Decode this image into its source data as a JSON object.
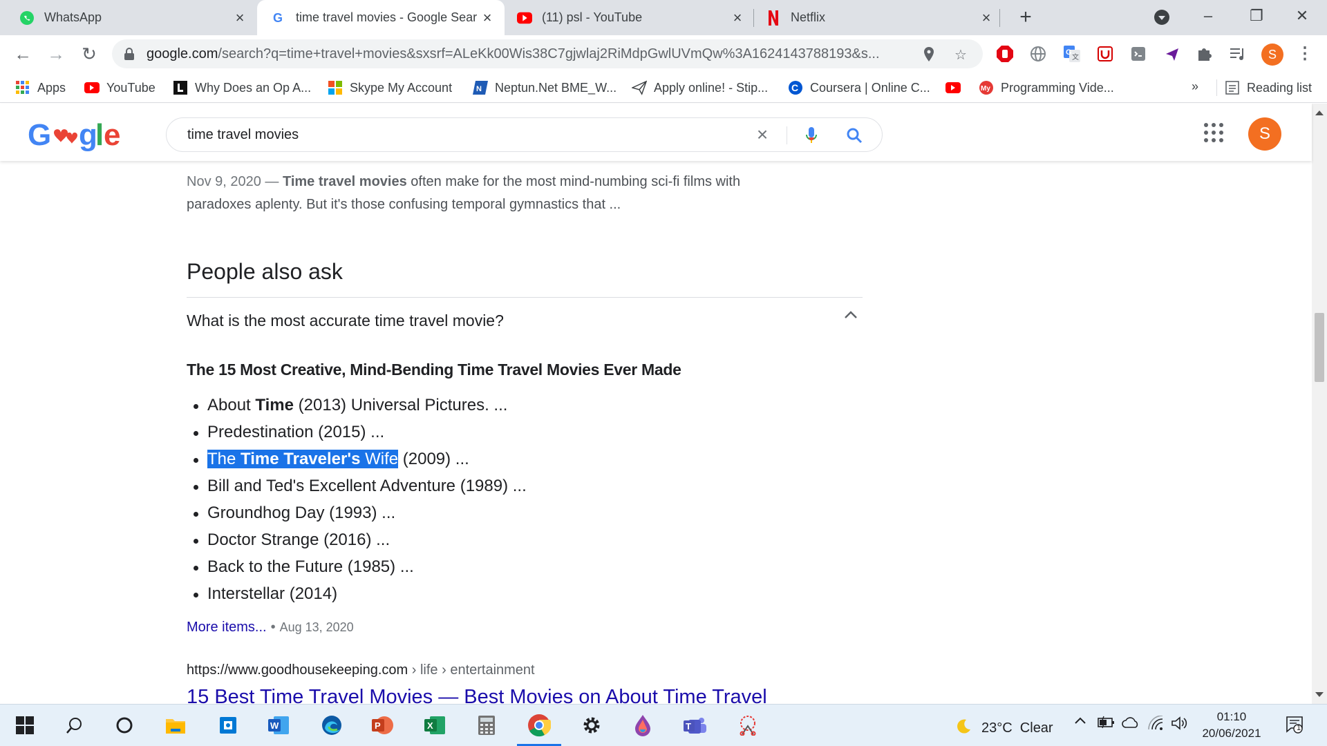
{
  "browser": {
    "tabs": [
      {
        "title": "WhatsApp",
        "icon": "whatsapp-icon",
        "active": false
      },
      {
        "title": "time travel movies - Google Sear",
        "icon": "google-icon",
        "active": true
      },
      {
        "title": "(11) psl - YouTube",
        "icon": "youtube-icon",
        "active": false
      },
      {
        "title": "Netflix",
        "icon": "netflix-icon",
        "active": false
      }
    ],
    "new_tab_label": "+",
    "url_host": "google.com",
    "url_rest": "/search?q=time+travel+movies&sxsrf=ALeKk00Wis38C7gjwlaj2RiMdpGwlUVmQw%3A1624143788193&s...",
    "profile_initial": "S",
    "bookmarks": [
      {
        "label": "Apps",
        "icon": "apps-icon"
      },
      {
        "label": "YouTube",
        "icon": "youtube-icon"
      },
      {
        "label": "Why Does an Op A...",
        "icon": "l-logo-icon"
      },
      {
        "label": "Skype My Account",
        "icon": "microsoft-icon"
      },
      {
        "label": "Neptun.Net BME_W...",
        "icon": "neptun-icon"
      },
      {
        "label": "Apply online! - Stip...",
        "icon": "paper-plane-icon"
      },
      {
        "label": "Coursera | Online C...",
        "icon": "coursera-icon"
      },
      {
        "label": "",
        "icon": "youtube-icon"
      },
      {
        "label": "Programming Vide...",
        "icon": "my-icon"
      }
    ],
    "bookmarks_more": "»",
    "reading_list": "Reading list"
  },
  "google": {
    "logo_text": "Google",
    "query": "time travel movies",
    "avatar_initial": "S"
  },
  "result_snippet": {
    "date": "Nov 9, 2020",
    "dash": " — ",
    "bold": "Time travel movies",
    "text": " often make for the most mind-numbing sci-fi films with paradoxes aplenty. But it's those confusing temporal gymnastics that ..."
  },
  "paa": {
    "title": "People also ask",
    "question": "What is the most accurate time travel movie?",
    "answer_title": "The 15 Most Creative, Mind-Bending Time Travel Movies Ever Made",
    "items": [
      {
        "pre": "About ",
        "bold": "Time",
        "post": " (2013) Universal Pictures. ..."
      },
      {
        "pre": "Predestination (2015) ...",
        "bold": "",
        "post": ""
      },
      {
        "hl_pre": "The ",
        "hl_bold": "Time Traveler's",
        "hl_post": " Wife",
        "post": " (2009) ..."
      },
      {
        "pre": "Bill and Ted's Excellent Adventure (1989) ...",
        "bold": "",
        "post": ""
      },
      {
        "pre": "Groundhog Day (1993) ...",
        "bold": "",
        "post": ""
      },
      {
        "pre": "Doctor Strange (2016) ...",
        "bold": "",
        "post": ""
      },
      {
        "pre": "Back to the Future (1985) ...",
        "bold": "",
        "post": ""
      },
      {
        "pre": "Interstellar (2014)",
        "bold": "",
        "post": ""
      }
    ],
    "more_items": "More items...",
    "more_date": "Aug 13, 2020"
  },
  "next_result": {
    "cite_host": "https://www.goodhousekeeping.com",
    "cite_path": " › life › entertainment",
    "title": "15 Best Time Travel Movies — Best Movies on About Time Travel"
  },
  "taskbar": {
    "weather": "23°C  Clear",
    "time": "01:10",
    "date": "20/06/2021",
    "notifications": "1"
  },
  "colors": {
    "google_blue": "#4285f4",
    "google_red": "#ea4335",
    "google_yellow": "#fbbc05",
    "google_green": "#34a853",
    "link": "#1a0dab",
    "highlight": "#1a73e8",
    "avatar": "#f36f21"
  }
}
